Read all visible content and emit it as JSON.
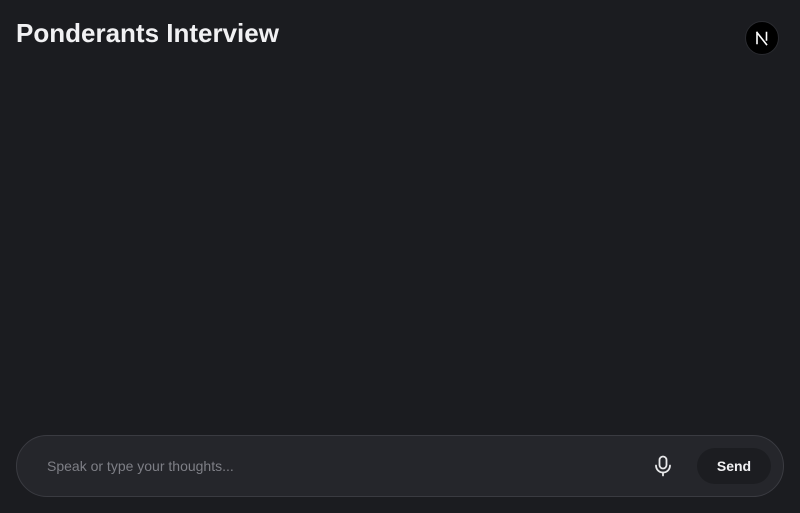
{
  "header": {
    "title": "Ponderants Interview",
    "avatar_initial": "N"
  },
  "composer": {
    "placeholder": "Speak or type your thoughts...",
    "value": "",
    "mic_icon": "microphone-icon",
    "send_label": "Send"
  },
  "colors": {
    "background": "#1b1c20",
    "composer_bg": "#25262b",
    "composer_border": "#3a3b41",
    "send_bg": "#1c1d21",
    "text": "#f1f1f3",
    "placeholder": "#7e7f86",
    "avatar_bg": "#000000"
  }
}
